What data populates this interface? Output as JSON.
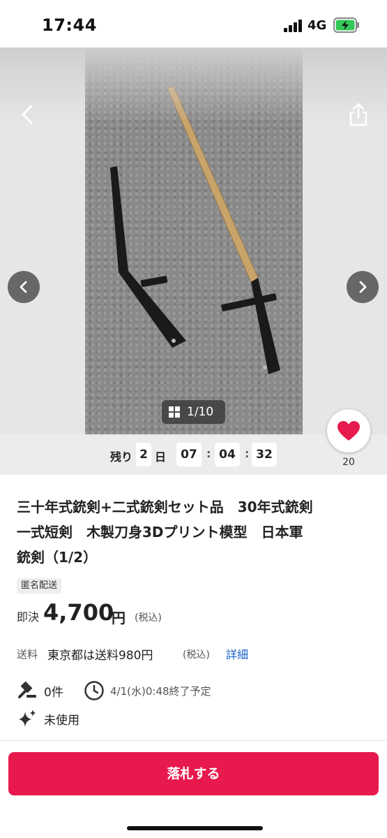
{
  "status_bar": {
    "time": "17:44",
    "network": "4G"
  },
  "gallery": {
    "image_counter": "1/10",
    "icons": {
      "back": "chevron-left-icon",
      "share": "share-icon",
      "prev": "chevron-left-icon",
      "next": "chevron-right-icon",
      "grid": "grid-icon"
    }
  },
  "timer": {
    "label_prefix": "残り",
    "days": "2",
    "days_unit": "日",
    "hours": "07",
    "minutes": "04",
    "seconds": "32",
    "separator": ":"
  },
  "favorite": {
    "count": "20",
    "color": "#e8194d"
  },
  "item": {
    "title_line1": "三十年式銃剣+二式銃剣セット品　30年式銃剣",
    "title_line2": "一式短剣　木製刀身3Dプリント模型　日本軍",
    "title_line3": "銃剣（1/2）",
    "badge": "匿名配送",
    "price_label": "即決",
    "price": "4,700",
    "price_unit": "円",
    "price_tax": "(税込)",
    "shipping_label": "送料",
    "shipping_text": "東京都は送料980円",
    "shipping_tax": "(税込)",
    "shipping_link": "詳細",
    "bids": "0件",
    "end_time": "4/1(水)0:48終了予定",
    "condition": "未使用"
  },
  "actions": {
    "bid_button": "落札する",
    "accent_color": "#e8194d"
  }
}
